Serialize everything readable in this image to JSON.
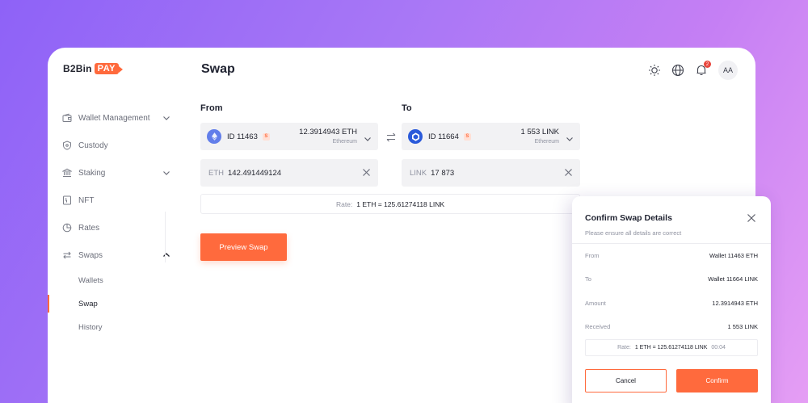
{
  "brand": {
    "name": "B2Bin",
    "badge": "PAY"
  },
  "sidebar": {
    "items": [
      {
        "label": "Wallet Management",
        "icon": "wallet-icon"
      },
      {
        "label": "Custody",
        "icon": "shield-icon"
      },
      {
        "label": "Staking",
        "icon": "bank-icon"
      },
      {
        "label": "NFT",
        "icon": "nft-icon"
      },
      {
        "label": "Rates",
        "icon": "pie-chart-icon"
      },
      {
        "label": "Swaps",
        "icon": "swap-icon"
      }
    ],
    "sub_items": [
      {
        "label": "Wallets"
      },
      {
        "label": "Swap"
      },
      {
        "label": "History"
      }
    ]
  },
  "header": {
    "title": "Swap",
    "notifications": "2",
    "avatar": "AA"
  },
  "swap": {
    "from": {
      "label": "From",
      "wallet_id": "ID 11463",
      "badge": "S",
      "balance": "12.3914943 ETH",
      "network": "Ethereum",
      "currency": "ETH",
      "amount": "142.491449124"
    },
    "to": {
      "label": "To",
      "wallet_id": "ID 11664",
      "badge": "S",
      "balance": "1 553 LINK",
      "network": "Ethereum",
      "currency": "LINK",
      "amount": "17 873"
    },
    "rate_label": "Rate:",
    "rate_value": "1 ETH = 125.61274118 LINK",
    "preview_button": "Preview Swap"
  },
  "modal": {
    "title": "Confirm Swap Details",
    "subtitle": "Please ensure all details are correct",
    "rows": [
      {
        "key": "From",
        "value": "Wallet 11463 ETH"
      },
      {
        "key": "To",
        "value": "Wallet 11664 LINK"
      },
      {
        "key": "Amount",
        "value": "12.3914943 ETH"
      },
      {
        "key": "Received",
        "value": "1 553 LINK"
      }
    ],
    "rate_label": "Rate:",
    "rate_value": "1 ETH = 125.61274118 LINK",
    "timer": "00:04",
    "cancel": "Cancel",
    "confirm": "Confirm"
  },
  "colors": {
    "accent": "#ff6a3d",
    "eth": "#627eea",
    "link": "#2a5ada"
  }
}
